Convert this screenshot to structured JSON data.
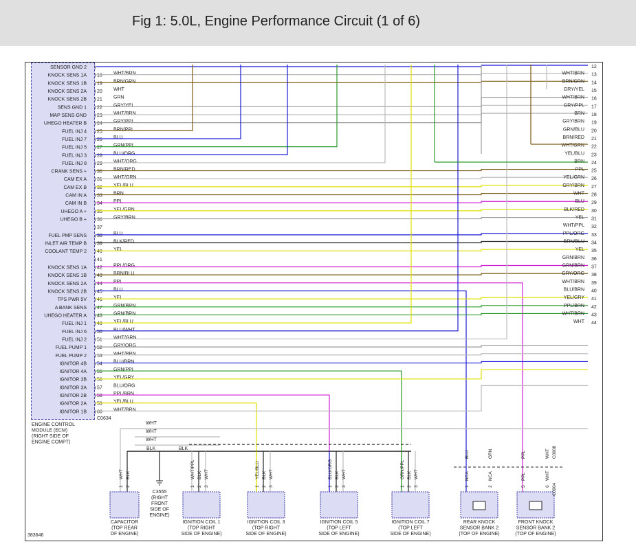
{
  "title": "Fig 1: 5.0L, Engine Performance Circuit (1 of 6)",
  "figure_id": "383646",
  "ecm": {
    "connector": "C0634",
    "label": [
      "ENGINE CONTROL",
      "MODULE (ECM)",
      "(RIGHT SIDE OF",
      "ENGINE COMPT)"
    ],
    "pins": [
      {
        "name": "SENSOR GND 2",
        "pin": "",
        "wire": ""
      },
      {
        "name": "KNOCK SENS 1A",
        "pin": "18",
        "wire": "WHT/BRN"
      },
      {
        "name": "KNOCK SENS 1B",
        "pin": "19",
        "wire": "BRN/GRN"
      },
      {
        "name": "KNOCK SENS 2A",
        "pin": "20",
        "wire": "WHT"
      },
      {
        "name": "KNOCK SENS 2B",
        "pin": "21",
        "wire": "GRN"
      },
      {
        "name": "SENS GND 1",
        "pin": "22",
        "wire": "GRY/YEL"
      },
      {
        "name": "MAP SENS GND",
        "pin": "23",
        "wire": "WHT/BRN"
      },
      {
        "name": "UHEGO HEATER B",
        "pin": "24",
        "wire": "GRY/PPL"
      },
      {
        "name": "FUEL INJ 4",
        "pin": "25",
        "wire": "BRN/PPL"
      },
      {
        "name": "FUEL INJ 7",
        "pin": "26",
        "wire": "BLU"
      },
      {
        "name": "FUEL INJ 5",
        "pin": "27",
        "wire": "GRN/PPL"
      },
      {
        "name": "FUEL INJ 3",
        "pin": "28",
        "wire": "BLU/ORG"
      },
      {
        "name": "FUEL INJ 8",
        "pin": "29",
        "wire": "WHT/ORG"
      },
      {
        "name": "CRANK SENS +",
        "pin": "30",
        "wire": "BRN/RED"
      },
      {
        "name": "CAM EX A",
        "pin": "31",
        "wire": "WHT/GRN"
      },
      {
        "name": "CAM EX B",
        "pin": "32",
        "wire": "YEL/BLU"
      },
      {
        "name": "CAM IN A",
        "pin": "33",
        "wire": "BRN"
      },
      {
        "name": "CAM IN B",
        "pin": "34",
        "wire": "PPL"
      },
      {
        "name": "UHEGO A +",
        "pin": "35",
        "wire": "YEL/GRN"
      },
      {
        "name": "UHEGO B +",
        "pin": "36",
        "wire": "GRY/BRN"
      },
      {
        "name": "",
        "pin": "37",
        "wire": ""
      },
      {
        "name": "FUEL PMP SENS",
        "pin": "38",
        "wire": "BLU"
      },
      {
        "name": "INLET AIR TEMP B",
        "pin": "39",
        "wire": "BLK/RED"
      },
      {
        "name": "COOLANT TEMP 2",
        "pin": "40",
        "wire": "YEL"
      },
      {
        "name": "",
        "pin": "41",
        "wire": ""
      },
      {
        "name": "KNOCK SENS 1A",
        "pin": "42",
        "wire": "PPL/ORG"
      },
      {
        "name": "KNOCK SENS 1B",
        "pin": "43",
        "wire": "BRN/BLU"
      },
      {
        "name": "KNOCK SENS 2A",
        "pin": "44",
        "wire": "PPL"
      },
      {
        "name": "KNOCK SENS 2B",
        "pin": "45",
        "wire": "BLU"
      },
      {
        "name": "TPS PWR 5V",
        "pin": "46",
        "wire": "YEL"
      },
      {
        "name": "A BANK SENS",
        "pin": "47",
        "wire": "GRN/BRN"
      },
      {
        "name": "UHEGO HEATER A",
        "pin": "48",
        "wire": "GRN/BRN"
      },
      {
        "name": "FUEL INJ 1",
        "pin": "49",
        "wire": "YEL/BLU"
      },
      {
        "name": "FUEL INJ 6",
        "pin": "50",
        "wire": "BLU/WHT"
      },
      {
        "name": "FUEL INJ 2",
        "pin": "51",
        "wire": "WHT/GRN"
      },
      {
        "name": "FUEL PUMP 1",
        "pin": "52",
        "wire": "GRY/ORG"
      },
      {
        "name": "FUEL PUMP 2",
        "pin": "53",
        "wire": "WHT/BRN"
      },
      {
        "name": "IGNITOR 4B",
        "pin": "54",
        "wire": "BLU/BRN"
      },
      {
        "name": "IGNITOR 4A",
        "pin": "55",
        "wire": "GRN/PPL"
      },
      {
        "name": "IGNITOR 3B",
        "pin": "56",
        "wire": "YEL/GRY"
      },
      {
        "name": "IGNITOR 3A",
        "pin": "57",
        "wire": "BLU/ORG"
      },
      {
        "name": "IGNITOR 2B",
        "pin": "58",
        "wire": "PPL/BRN"
      },
      {
        "name": "IGNITOR 2A",
        "pin": "59",
        "wire": "YEL/BLU"
      },
      {
        "name": "IGNITOR 1B",
        "pin": "60",
        "wire": "WHT/BRN"
      }
    ]
  },
  "right_wires": [
    {
      "num": "12",
      "wire": ""
    },
    {
      "num": "13",
      "wire": "WHT/BRN"
    },
    {
      "num": "14",
      "wire": "BRN/GRN"
    },
    {
      "num": "15",
      "wire": "GRY/YEL"
    },
    {
      "num": "16",
      "wire": "WHT/BRN"
    },
    {
      "num": "17",
      "wire": "GRY/PPL"
    },
    {
      "num": "18",
      "wire": "BRN"
    },
    {
      "num": "19",
      "wire": "GRY/BRN"
    },
    {
      "num": "20",
      "wire": "GRN/BLU"
    },
    {
      "num": "21",
      "wire": "BRN/RED"
    },
    {
      "num": "22",
      "wire": "WHT/GRN"
    },
    {
      "num": "23",
      "wire": "YEL/BLU"
    },
    {
      "num": "24",
      "wire": "BRN"
    },
    {
      "num": "25",
      "wire": "PPL"
    },
    {
      "num": "26",
      "wire": "YEL/GRN"
    },
    {
      "num": "27",
      "wire": "GRY/BRN"
    },
    {
      "num": "28",
      "wire": "WHT"
    },
    {
      "num": "29",
      "wire": "BLU"
    },
    {
      "num": "30",
      "wire": "BLK/RED"
    },
    {
      "num": "31",
      "wire": "YEL"
    },
    {
      "num": "32",
      "wire": "WHT/PPL"
    },
    {
      "num": "33",
      "wire": "PPL/ORG"
    },
    {
      "num": "34",
      "wire": "BRN/BLU"
    },
    {
      "num": "35",
      "wire": "YEL"
    },
    {
      "num": "36",
      "wire": "GRN/BRN"
    },
    {
      "num": "37",
      "wire": "GRN/BRN"
    },
    {
      "num": "38",
      "wire": "GRY/ORG"
    },
    {
      "num": "39",
      "wire": "WHT/BRN"
    },
    {
      "num": "40",
      "wire": "BLU/BRN"
    },
    {
      "num": "41",
      "wire": "YEL/GRY"
    },
    {
      "num": "42",
      "wire": "PPL/BRN"
    },
    {
      "num": "43",
      "wire": "WHT/BRN"
    },
    {
      "num": "44",
      "wire": "WHT"
    }
  ],
  "ground_wires": [
    "WHT",
    "WHT",
    "WHT",
    "BLK",
    "BLK"
  ],
  "components": [
    {
      "id": "capacitor",
      "label": [
        "CAPACITOR",
        "(TOP REAR",
        "OF ENGINE)"
      ],
      "pin_wires": [
        "WHT",
        "BLK"
      ],
      "pin_nums": [
        "1",
        "2"
      ]
    },
    {
      "id": "coil1",
      "label": [
        "IGNITION COIL 1",
        "(TOP RIGHT",
        "SIDE OF ENGINE)"
      ],
      "pin_wires": [
        "WHT/PPL",
        "BLK",
        "WHT"
      ],
      "pin_nums": [
        "1",
        "2",
        "3"
      ]
    },
    {
      "id": "coil3",
      "label": [
        "IGNITION COIL 3",
        "(TOP RIGHT",
        "SIDE OF ENGINE)"
      ],
      "pin_wires": [
        "YEL/BLU",
        "BLK",
        "WHT"
      ],
      "pin_nums": [
        "1",
        "2",
        "3"
      ]
    },
    {
      "id": "coil5",
      "label": [
        "IGNITION COIL 5",
        "(TOP LEFT",
        "SIDE OF ENGINE)"
      ],
      "pin_wires": [
        "BLU/ORG",
        "BLK",
        "WHT"
      ],
      "pin_nums": [
        "1",
        "2",
        "3"
      ]
    },
    {
      "id": "coil7",
      "label": [
        "IGNITION COIL 7",
        "(TOP LEFT",
        "SIDE OF ENGINE)"
      ],
      "pin_wires": [
        "GRN/PPL",
        "BLK",
        "WHT"
      ],
      "pin_nums": [
        "1",
        "2",
        "3"
      ]
    },
    {
      "id": "rear-knock",
      "label": [
        "REAR KNOCK",
        "SENSOR BANK 2",
        "(TOP OF ENGINE)"
      ],
      "pin_wires": [
        "BLU",
        "GRN"
      ],
      "pin_nums": [
        "1",
        "2"
      ],
      "pin_tags": [
        "NCA",
        "NCA"
      ]
    },
    {
      "id": "front-knock",
      "label": [
        "FRONT KNOCK",
        "SENSOR BANK 2",
        "(TOP OF ENGINE)"
      ],
      "pin_wires": [
        "PPL",
        "WHT"
      ],
      "pin_nums": [
        "5",
        "6"
      ],
      "pin_tags": [
        "PPL",
        "WHT"
      ]
    }
  ],
  "ground": {
    "id": "C3555",
    "label": [
      "C3555",
      "(RIGHT",
      "FRONT",
      "SIDE OF",
      "ENGINE)"
    ]
  },
  "connectors": {
    "c0908": "C0908",
    "c0904": "C0904"
  },
  "colors": {
    "BLU": "#1a1ad6",
    "WHT": "#bbbbbb",
    "BRN": "#7a5a10",
    "GRN": "#2a9a2a",
    "GRY": "#999999",
    "YEL": "#e0e000",
    "PPL": "#d21ed2",
    "ORG": "#e0a060",
    "RED": "#cc2222",
    "BLK": "#222222"
  }
}
